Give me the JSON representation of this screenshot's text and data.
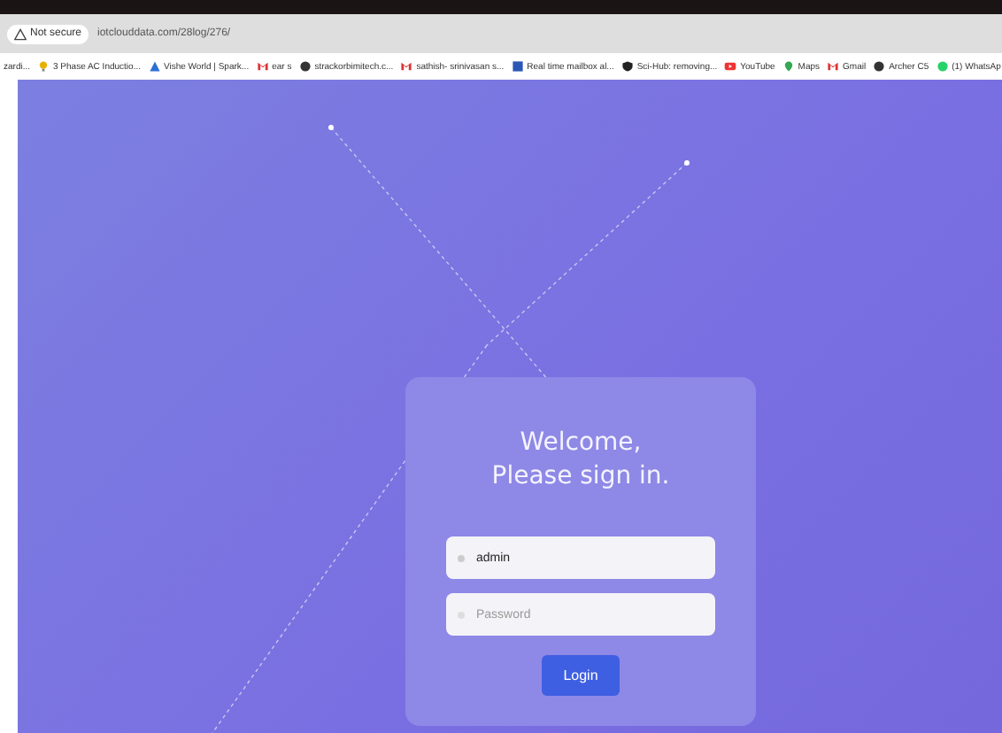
{
  "address_bar": {
    "security": "Not secure",
    "url": "iotclouddata.com/28log/276/"
  },
  "bookmarks": [
    {
      "label": "zardi..."
    },
    {
      "label": "3 Phase AC Inductio..."
    },
    {
      "label": "Vishe World | Spark..."
    },
    {
      "label": "ear s"
    },
    {
      "label": "strackorbimitech.c..."
    },
    {
      "label": "sathish- srinivasan s..."
    },
    {
      "label": "Real time mailbox al..."
    },
    {
      "label": "Sci-Hub: removing..."
    },
    {
      "label": "YouTube"
    },
    {
      "label": "Maps"
    },
    {
      "label": "Gmail"
    },
    {
      "label": "Archer C5"
    },
    {
      "label": "(1) WhatsAp"
    }
  ],
  "login": {
    "title": "Welcome,",
    "subtitle": "Please sign in.",
    "username": {
      "value": "admin"
    },
    "password": {
      "placeholder": "Password"
    },
    "button": "Login"
  }
}
